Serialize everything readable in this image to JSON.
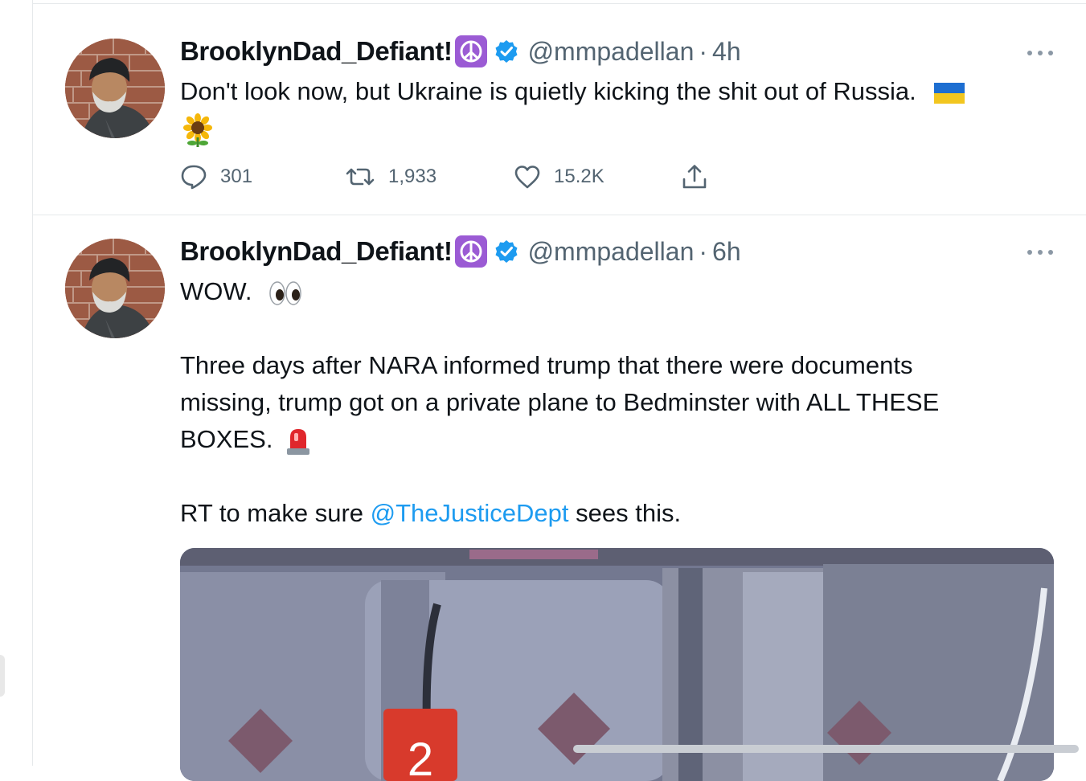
{
  "tweets": [
    {
      "author": "BrooklynDad_Defiant!",
      "author_emoji": "peace-symbol",
      "verified": true,
      "handle": "@mmpadellan",
      "separator": "·",
      "time": "4h",
      "text_lines": [
        "Don't look now, but Ukraine is quietly kicking the shit out of Russia."
      ],
      "text_emojis": [
        "ukraine-flag",
        "sunflower"
      ],
      "stats": {
        "replies": "301",
        "retweets": "1,933",
        "likes": "15.2K"
      }
    },
    {
      "author": "BrooklynDad_Defiant!",
      "author_emoji": "peace-symbol",
      "verified": true,
      "handle": "@mmpadellan",
      "separator": "·",
      "time": "6h",
      "text_line_1": "WOW.",
      "text_emoji_1": "eyes",
      "paragraph_2": [
        "Three days after NARA informed trump that there were documents",
        "missing, trump got on a private plane to Bedminster with ALL THESE",
        "BOXES."
      ],
      "text_emoji_2": "police-light",
      "paragraph_3_before": "RT to make sure",
      "mention": "@TheJusticeDept",
      "paragraph_3_after": "sees this.",
      "media_label": "2"
    }
  ],
  "colors": {
    "text": "#0f1419",
    "secondary": "#536471",
    "link": "#1d9bf0",
    "verified": "#1d9bf0",
    "divider": "#e6e9eb"
  }
}
